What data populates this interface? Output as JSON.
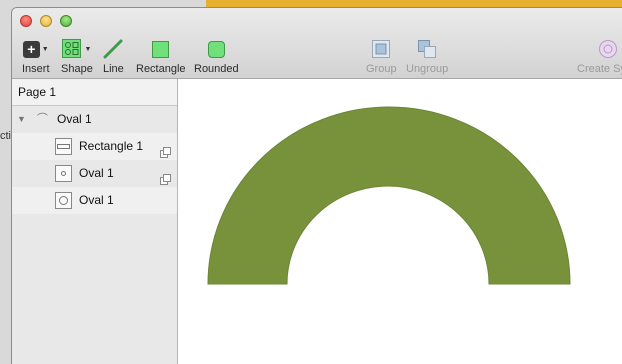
{
  "background": {
    "left_fragment": "ctiv"
  },
  "colors": {
    "shape_fill": "#78923c",
    "shape_stroke": "#6b8536",
    "accent_bg": "#e8b030"
  },
  "toolbar": {
    "insert": {
      "label": "Insert",
      "icon": "plus-icon"
    },
    "shape": {
      "label": "Shape",
      "icon": "shapes-icon"
    },
    "line": {
      "label": "Line",
      "icon": "line-icon"
    },
    "rectangle": {
      "label": "Rectangle",
      "icon": "rectangle-icon"
    },
    "rounded": {
      "label": "Rounded",
      "icon": "rounded-rectangle-icon"
    },
    "group": {
      "label": "Group",
      "icon": "group-icon"
    },
    "ungroup": {
      "label": "Ungroup",
      "icon": "ungroup-icon"
    },
    "create_symbol": {
      "label": "Create Sy",
      "icon": "symbol-icon"
    }
  },
  "sidebar": {
    "page": "Page 1",
    "layers": [
      {
        "name": "Oval 1",
        "type": "group"
      },
      {
        "name": "Rectangle 1",
        "type": "rectangle"
      },
      {
        "name": "Oval 1",
        "type": "oval"
      },
      {
        "name": "Oval 1",
        "type": "oval"
      }
    ]
  }
}
